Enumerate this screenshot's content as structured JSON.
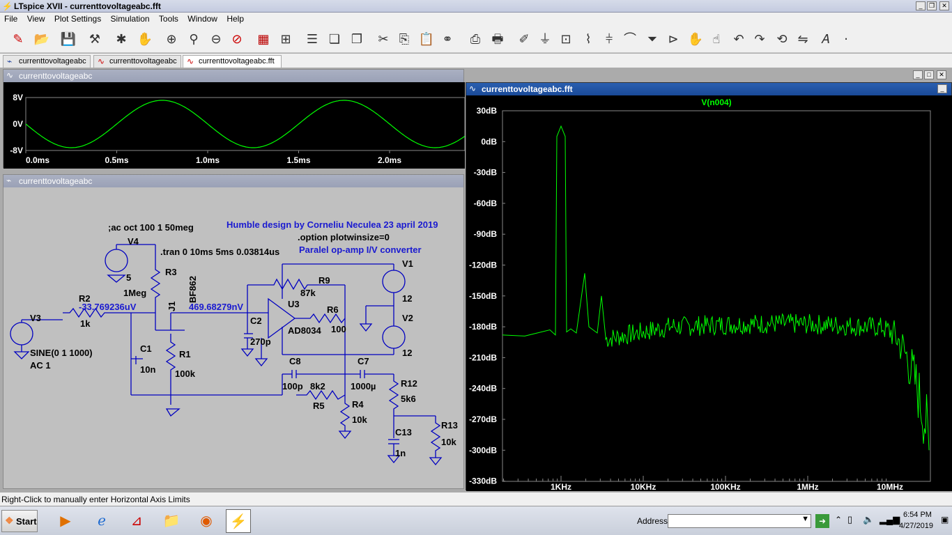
{
  "window": {
    "title": "LTspice XVII - currenttovoltageabc.fft",
    "min": "_",
    "restore": "❐",
    "close": "✕"
  },
  "menu": [
    "File",
    "View",
    "Plot Settings",
    "Simulation",
    "Tools",
    "Window",
    "Help"
  ],
  "tabs": [
    {
      "label": "currenttovoltageabc"
    },
    {
      "label": "currenttovoltageabc"
    },
    {
      "label": "currenttovoltageabc.fft"
    }
  ],
  "waveform_window": {
    "title": "currenttovoltageabc",
    "y_ticks": [
      "8V",
      "0V",
      "-8V"
    ],
    "x_ticks": [
      "0.0ms",
      "0.5ms",
      "1.0ms",
      "1.5ms",
      "2.0ms"
    ]
  },
  "schematic_window": {
    "title": "currenttovoltageabc",
    "labels": {
      "ac": ";ac oct 100 1 50meg",
      "tran": ".tran 0 10ms 5ms 0.03814us",
      "option": ".option plotwinsize=0",
      "credit": "Humble design by Corneliu Neculea 23 april 2019",
      "subtitle": "Paralel op-amp I/V converter",
      "v4": "V4",
      "v4val": "5",
      "r3": "R3",
      "r3val": "1Meg",
      "j1": "J1",
      "bf": "BF862",
      "r2": "R2",
      "r2val": "1k",
      "v3": "V3",
      "v3val": "SINE(0 1 1000)",
      "v3ac": "AC 1",
      "node1": "-33.769236uV",
      "node2": "469.68279nV",
      "c1": "C1",
      "c1val": "10n",
      "r1": "R1",
      "r1val": "100k",
      "r9": "R9",
      "r9val": "87k",
      "u3": "U3",
      "u3val": "AD8034",
      "r6": "R6",
      "r6val": "100",
      "c2": "C2",
      "c2val": "270p",
      "c8": "C8",
      "c8val": "100p",
      "r5": "R5",
      "r5val": "8k2",
      "r4": "R4",
      "r4val": "10k",
      "c7": "C7",
      "c7val": "1000µ",
      "r12": "R12",
      "r12val": "5k6",
      "c13": "C13",
      "c13val": "1n",
      "r13": "R13",
      "r13val": "10k",
      "v1": "V1",
      "v1val": "12",
      "v2": "V2",
      "v2val": "12"
    }
  },
  "fft_window": {
    "title": "currenttovoltageabc.fft",
    "trace": "V(n004)",
    "y_ticks": [
      "30dB",
      "0dB",
      "-30dB",
      "-60dB",
      "-90dB",
      "-120dB",
      "-150dB",
      "-180dB",
      "-210dB",
      "-240dB",
      "-270dB",
      "-300dB",
      "-330dB"
    ],
    "x_ticks": [
      "1KHz",
      "10KHz",
      "100KHz",
      "1MHz",
      "10MHz"
    ]
  },
  "status": "Right-Click to manually enter Horizontal Axis Limits",
  "taskbar": {
    "start": "Start",
    "address_label": "Address",
    "time": "6:54 PM",
    "date": "4/27/2019"
  },
  "colors": {
    "trace": "#00ff00",
    "wire": "#0000c0",
    "schematic_bg": "#c0c0c0"
  }
}
